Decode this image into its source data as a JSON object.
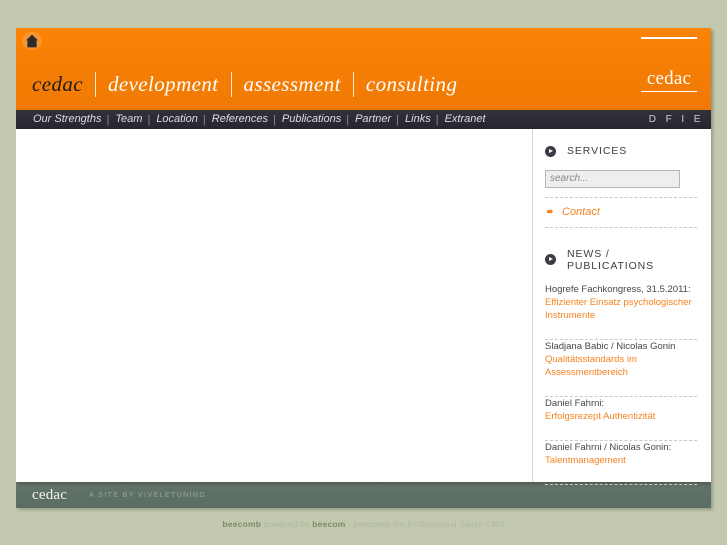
{
  "header": {
    "home_icon": "home-icon",
    "brand_first": "cedac",
    "brand_words": [
      "development",
      "assessment",
      "consulting"
    ],
    "logo_word": "cedac",
    "accent_color": "#f5821f",
    "header_bg": "#f77f08"
  },
  "nav": {
    "items": [
      {
        "label": "Our Strengths"
      },
      {
        "label": "Team"
      },
      {
        "label": "Location"
      },
      {
        "label": "References"
      },
      {
        "label": "Publications"
      },
      {
        "label": "Partner"
      },
      {
        "label": "Links"
      },
      {
        "label": "Extranet"
      }
    ],
    "separator": "|",
    "languages": [
      "D",
      "F",
      "I",
      "E"
    ],
    "nav_bg": "#2a2a33"
  },
  "sidebar": {
    "services": {
      "heading": "SERVICES",
      "search_placeholder": "search...",
      "search_value": "",
      "contact_label": "Contact"
    },
    "news": {
      "heading": "NEWS / PUBLICATIONS",
      "items": [
        {
          "author": "Hogrefe Fachkongress, 31.5.2011:",
          "title": "Effizienter Einsatz psychologischer Instrumente"
        },
        {
          "author": "Sladjana Babic / Nicolas Gonin",
          "title": "Qualitätsstandards im Assessmentbereich"
        },
        {
          "author": "Daniel Fahrni:",
          "title": "Erfolgsrezept Authentizität"
        },
        {
          "author": "Daniel Fahrni / Nicolas Gonin:",
          "title": "Talentmanagement"
        }
      ]
    }
  },
  "footer": {
    "brand": "cedac",
    "credit": "A SITE BY VIVELETUNING",
    "bottom_strong_1": "beecomb",
    "bottom_mid": "powered by",
    "bottom_strong_2": "beecom",
    "bottom_tail": "- beecomb the Professional Swiss CMS"
  }
}
